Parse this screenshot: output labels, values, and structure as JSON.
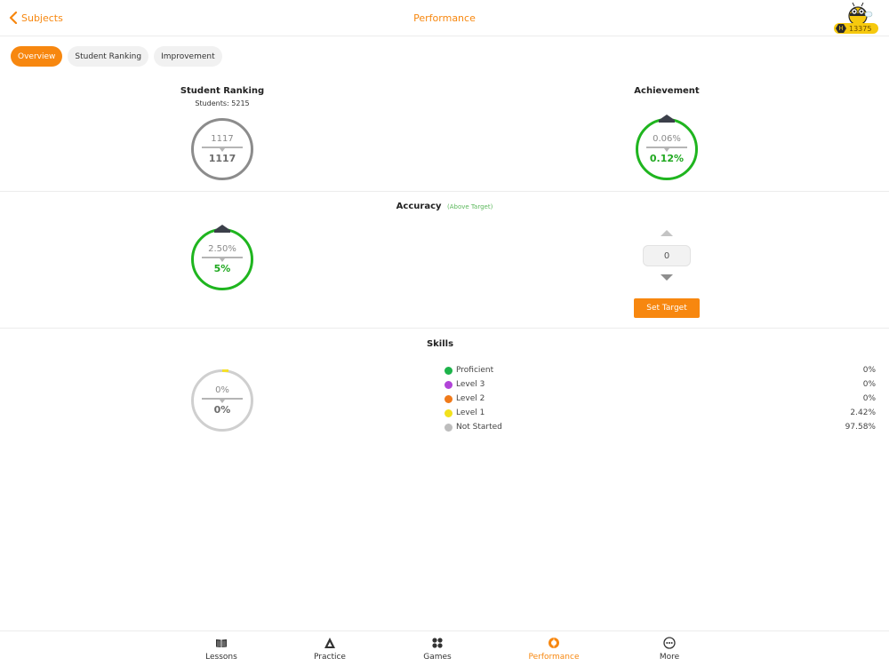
{
  "header": {
    "back_label": "Subjects",
    "title": "Performance",
    "coins": "13375",
    "coin_letter": "H"
  },
  "tabs": [
    {
      "label": "Overview",
      "active": true
    },
    {
      "label": "Student Ranking",
      "active": false
    },
    {
      "label": "Improvement",
      "active": false
    }
  ],
  "ranking": {
    "title": "Student Ranking",
    "students": "Students: 5215",
    "previous": "1117",
    "current": "1117"
  },
  "achievement": {
    "title": "Achievement",
    "previous": "0.06%",
    "current": "0.12%"
  },
  "accuracy": {
    "title": "Accuracy",
    "status": "(Above Target)",
    "previous": "2.50%",
    "current": "5%",
    "target_value": "0",
    "set_target_label": "Set Target"
  },
  "skills": {
    "title": "Skills",
    "previous": "0%",
    "current": "0%",
    "legend": [
      {
        "label": "Proficient",
        "value": "0%",
        "color": "#1db34a"
      },
      {
        "label": "Level 3",
        "value": "0%",
        "color": "#b144d8"
      },
      {
        "label": "Level 2",
        "value": "0%",
        "color": "#f07a1a"
      },
      {
        "label": "Level 1",
        "value": "2.42%",
        "color": "#f2e11c"
      },
      {
        "label": "Not Started",
        "value": "97.58%",
        "color": "#bdbdbd"
      }
    ]
  },
  "colors": {
    "accent": "#f7870f",
    "positive": "#1fb51f"
  },
  "nav": [
    {
      "label": "Lessons",
      "icon": "book-icon",
      "active": false
    },
    {
      "label": "Practice",
      "icon": "triangle-icon",
      "active": false
    },
    {
      "label": "Games",
      "icon": "games-icon",
      "active": false
    },
    {
      "label": "Performance",
      "icon": "performance-icon",
      "active": true
    },
    {
      "label": "More",
      "icon": "more-icon",
      "active": false
    }
  ]
}
